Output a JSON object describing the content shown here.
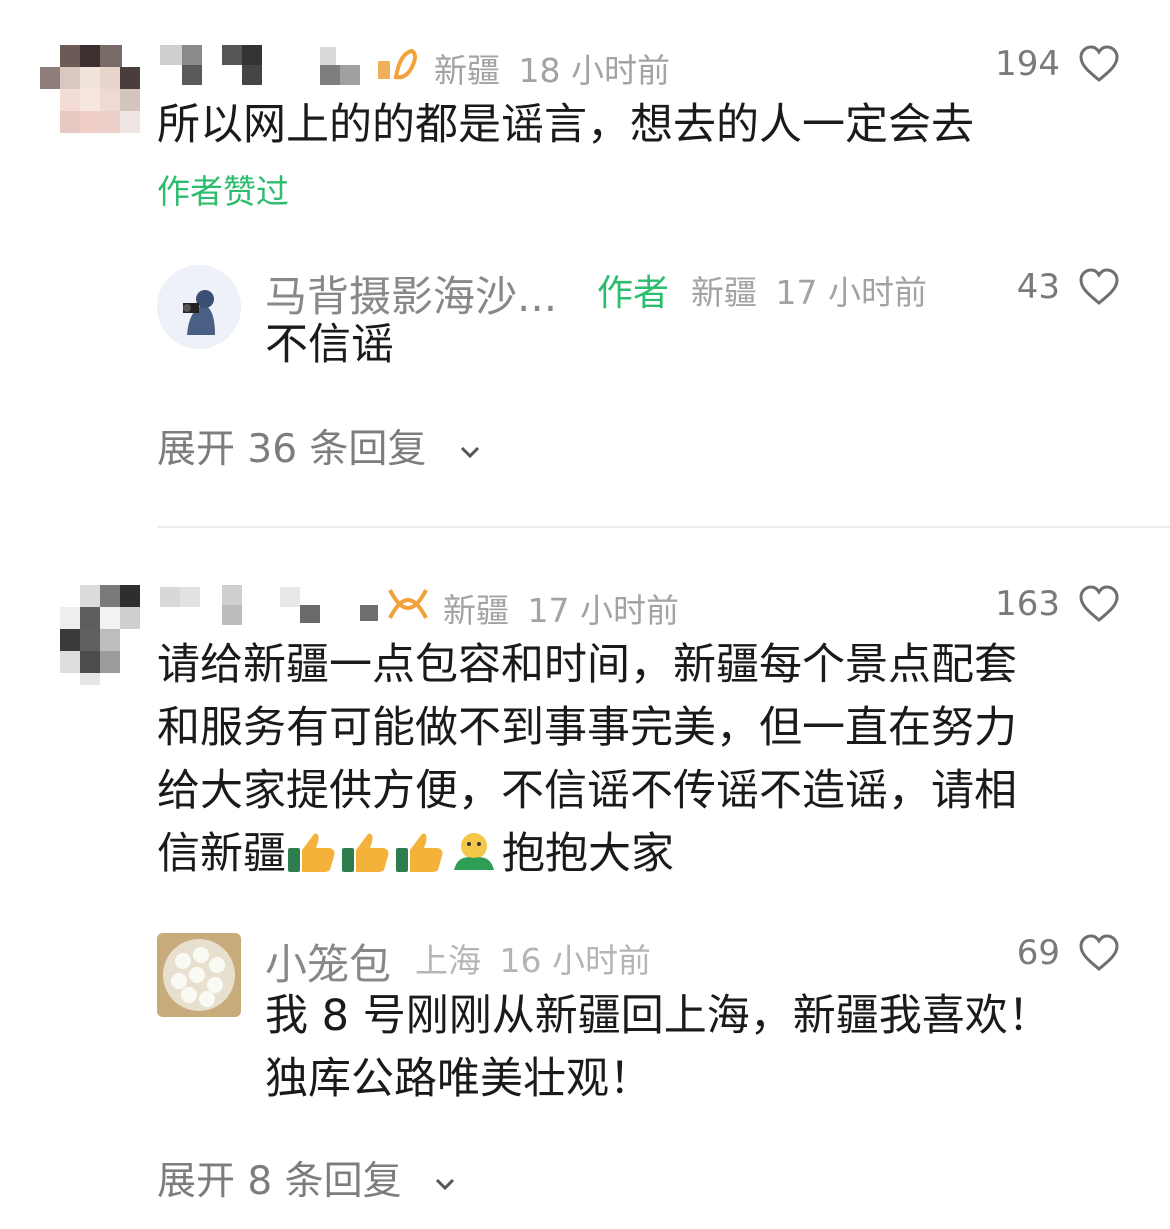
{
  "comments": [
    {
      "location": "新疆",
      "time": "18 小时前",
      "likes": "194",
      "text": "所以网上的的都是谣言，想去的人一定会去",
      "author_liked": "作者赞过",
      "reply": {
        "username": "马背摄影海沙...",
        "author_tag": "作者",
        "location": "新疆",
        "time": "17 小时前",
        "likes": "43",
        "text": "不信谣"
      },
      "expand_label": "展开 36 条回复"
    },
    {
      "location": "新疆",
      "time": "17 小时前",
      "likes": "163",
      "text_lines": [
        "请给新疆一点包容和时间，新疆每个景点配套",
        "和服务有可能做不到事事完美，但一直在努力",
        "给大家提供方便，不信谣不传谣不造谣，请相"
      ],
      "text_last_prefix": "信新疆",
      "text_last_suffix": "抱抱大家",
      "reply": {
        "username": "小笼包",
        "location": "上海",
        "time": "16 小时前",
        "likes": "69",
        "text_lines": [
          "我 8 号刚刚从新疆回上海，新疆我喜欢！",
          "独库公路唯美壮观！"
        ]
      },
      "expand_label": "展开 8 条回复"
    }
  ],
  "icons": {
    "like": "heart-outline-icon",
    "expand": "chevron-down-icon",
    "thumbs_up": "thumbs-up-emoji",
    "hug": "hug-emoji"
  },
  "colors": {
    "accent_green": "#2dbd6e",
    "meta_gray": "#a3a3a3"
  }
}
